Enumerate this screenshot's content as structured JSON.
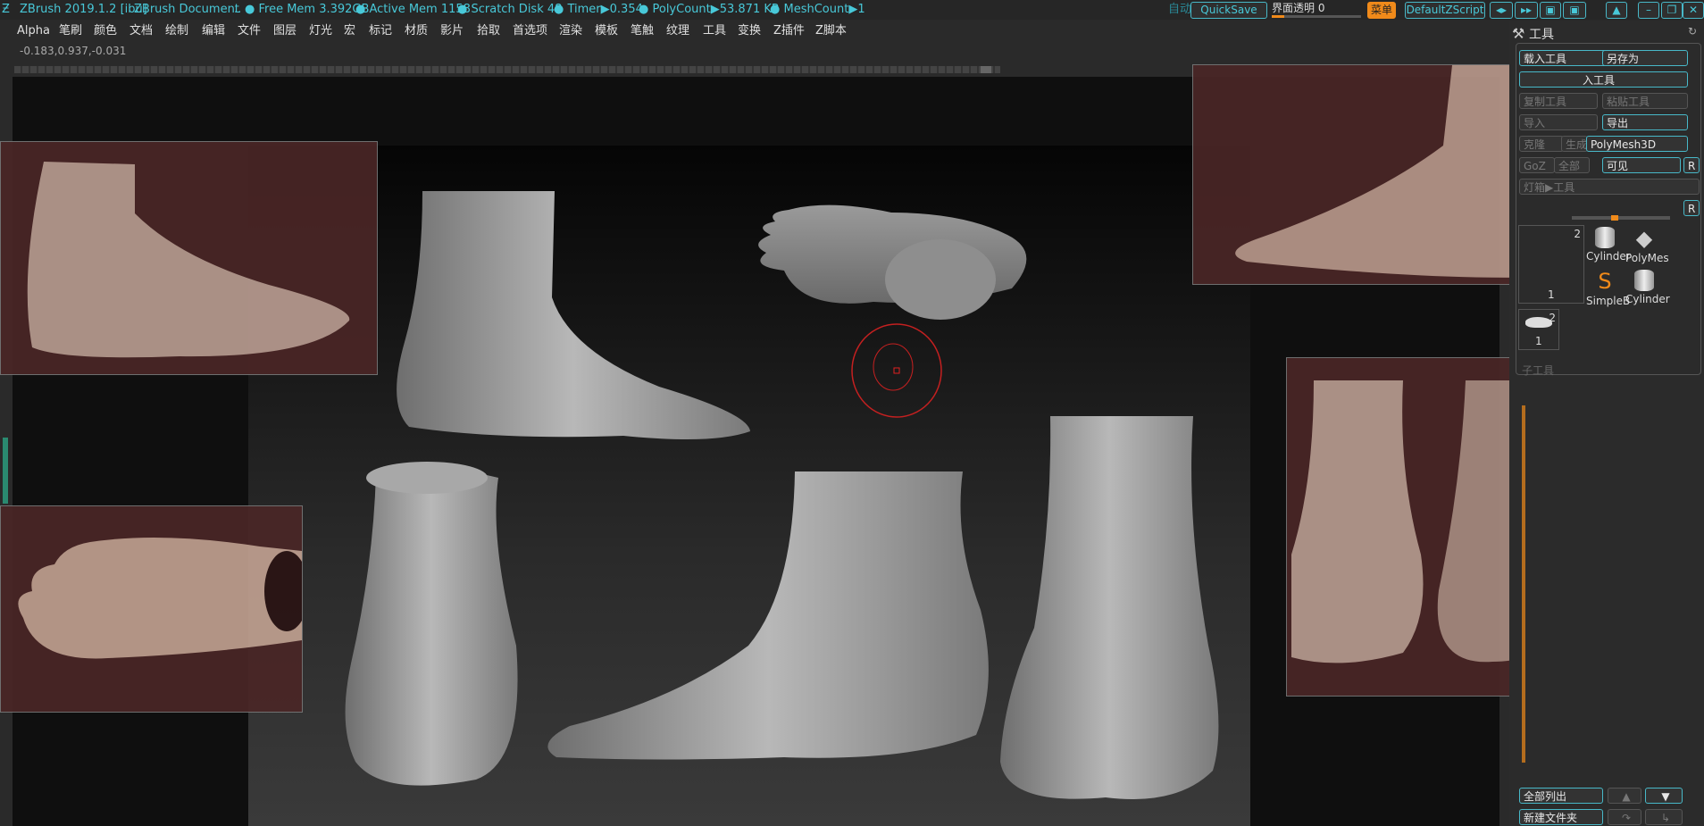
{
  "titlebar": {
    "app": "ZBrush 2019.1.2 [ibu]",
    "doc": "ZBrush Document",
    "ellipsis": "..",
    "free_mem": "Free Mem 3.392GB",
    "active_mem": "Active Mem 1158",
    "scratch": "Scratch Disk 48",
    "timer": "Timer▶0.354",
    "polycount": "PolyCount▶53.871 KP",
    "meshcount": "MeshCount▶1",
    "auto": "自动",
    "quicksave": "QuickSave",
    "transparency": "界面透明 0",
    "menu_btn": "菜单",
    "script": "DefaultZScript"
  },
  "menus": [
    "Alpha",
    "笔刷",
    "颜色",
    "文档",
    "绘制",
    "编辑",
    "文件",
    "图层",
    "灯光",
    "宏",
    "标记",
    "材质",
    "影片",
    "拾取",
    "首选项",
    "渲染",
    "模板",
    "笔触",
    "纹理",
    "工具",
    "变换",
    "Z插件",
    "Z脚本"
  ],
  "coords": "-0.183,0.937,-0.031",
  "panel": {
    "title": "工具",
    "load_tool": "载入工具",
    "save_as": "另存为",
    "from_doc": "入工具",
    "copy_tool": "复制工具",
    "paste_tool": "粘贴工具",
    "import": "导入",
    "export": "导出",
    "clone": "克隆",
    "make": "生成",
    "polymesh": "PolyMesh3D",
    "go_z": "GoZ",
    "all": "全部",
    "visible": "可见",
    "r1": "R",
    "lightbox": "灯箱▶工具",
    "r2": "R",
    "thumbs": [
      {
        "label": "Cylinder",
        "count": ""
      },
      {
        "label": "PolyMes",
        "count": ""
      },
      {
        "label": "SimpleB",
        "count": ""
      },
      {
        "label": "Cylinder",
        "count": ""
      }
    ],
    "thumb_count_a": "2",
    "thumb_num_a": "1",
    "thumb_count_b": "2",
    "thumb_num_b": "1",
    "subtool": "子工具",
    "list_all": "全部列出",
    "new_folder": "新建文件夹"
  },
  "colors": {
    "accent": "#48c8d8",
    "orange": "#f08a1a",
    "ref_tint": "#4a2626"
  }
}
